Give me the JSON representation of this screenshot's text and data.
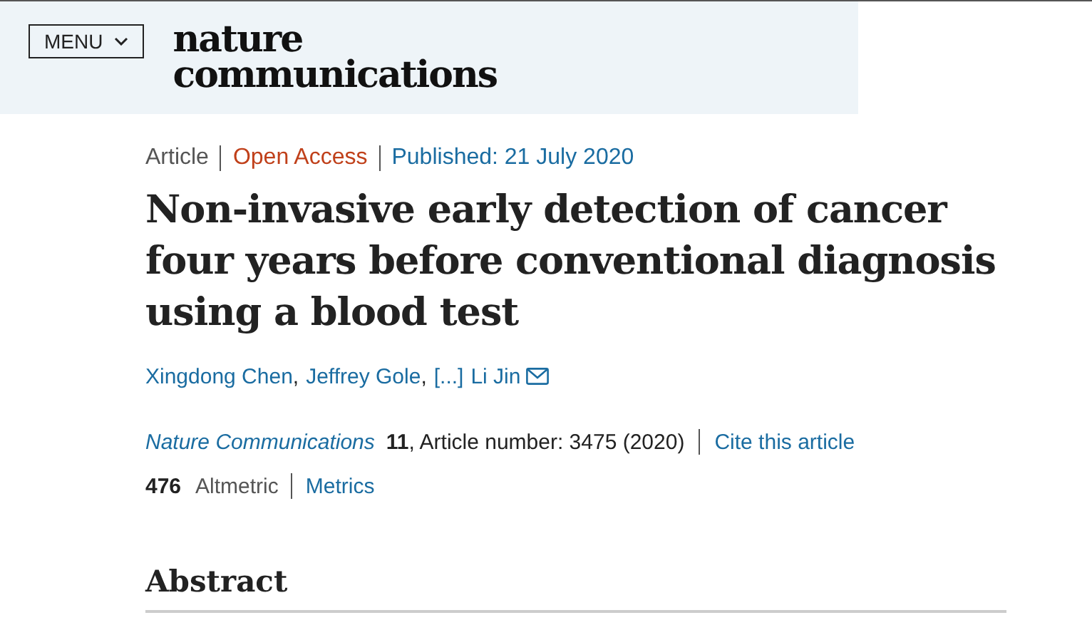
{
  "header": {
    "menu_button": "MENU",
    "logo_lines": [
      "nature",
      "communications"
    ]
  },
  "article_meta": [
    {
      "text": "Article",
      "kind": "type"
    },
    {
      "text": "Open Access",
      "kind": "access"
    },
    {
      "text": "Published: 21 July 2020",
      "kind": "date"
    }
  ],
  "title": "Non-invasive early detection of cancer four years before conventional diagnosis using a blood test",
  "authors": [
    {
      "text": "Xingdong Chen",
      "separator": ","
    },
    {
      "text": "Jeffrey Gole",
      "separator": ","
    },
    {
      "text": "[...]"
    },
    {
      "text": "Li Jin",
      "contact": true
    }
  ],
  "citation": {
    "journal": "Nature Communications",
    "volume": "11",
    "details": ", Article number: 3475 (2020)",
    "cite_link": "Cite this article"
  },
  "metrics": {
    "count": "476",
    "label": "Altmetric",
    "link": "Metrics"
  },
  "section_heading": "Abstract"
}
